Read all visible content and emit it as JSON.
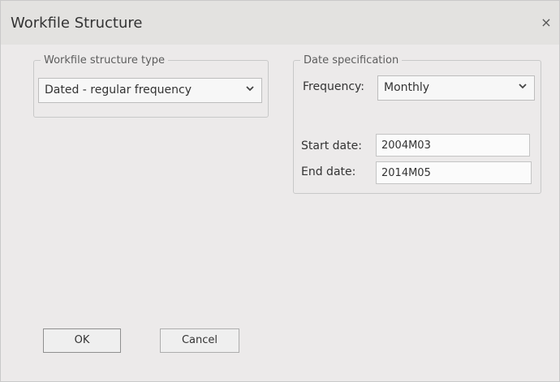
{
  "window": {
    "title": "Workfile Structure",
    "close_glyph": "×"
  },
  "structure_group": {
    "legend": "Workfile structure type",
    "selected": "Dated - regular frequency"
  },
  "date_group": {
    "legend": "Date specification",
    "frequency_label": "Frequency:",
    "frequency_value": "Monthly",
    "start_label": "Start date:",
    "start_value": "2004M03",
    "end_label": "End date:",
    "end_value": "2014M05"
  },
  "buttons": {
    "ok": "OK",
    "cancel": "Cancel"
  },
  "icons": {
    "close": "close-icon",
    "dropdown": "chevron-down-icon"
  },
  "colors": {
    "background": "#eceaea",
    "titlebar": "#e3e2e0",
    "border": "#c8c8c8"
  }
}
